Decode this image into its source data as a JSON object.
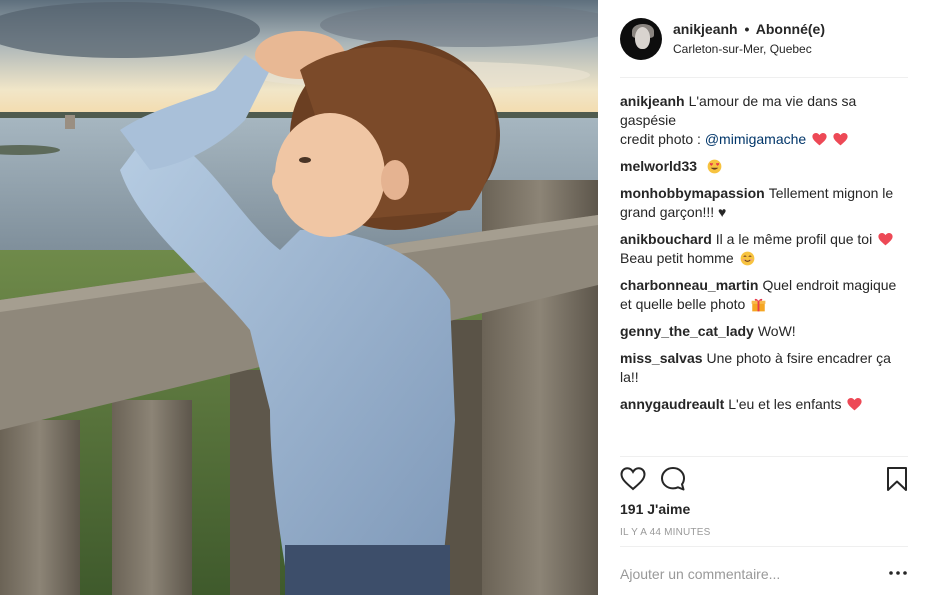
{
  "header": {
    "username": "anikjeanh",
    "separator": "•",
    "follow_status": "Abonné(e)",
    "location": "Carleton-sur-Mer, Quebec"
  },
  "caption": {
    "user": "anikjeanh",
    "text_line1": "L'amour de ma vie dans sa gaspésie",
    "text_prefix": "credit photo :",
    "mention": "@mimigamache",
    "emoji": [
      "red-heart",
      "red-heart"
    ]
  },
  "comments": [
    {
      "user": "melworld33",
      "text": "",
      "emoji": "heart-eyes-face"
    },
    {
      "user": "monhobbymapassion",
      "text": "Tellement mignon le grand garçon!!! ♥",
      "emoji": ""
    },
    {
      "user": "anikbouchard",
      "text": "Il a le même profil que toi",
      "text2": "Beau petit homme",
      "emoji": "red-heart",
      "emoji2": "smiling-face"
    },
    {
      "user": "charbonneau_martin",
      "text": "Quel endroit magique et quelle belle photo",
      "emoji": "gift"
    },
    {
      "user": "genny_the_cat_lady",
      "text": "WoW!",
      "emoji": ""
    },
    {
      "user": "miss_salvas",
      "text": "Une photo à fsire encadrer ça la!!",
      "emoji": ""
    },
    {
      "user": "annygaudreault",
      "text": "L'eu et les enfants",
      "emoji": "red-heart"
    }
  ],
  "actions": {
    "like_icon": "heart-outline-icon",
    "comment_icon": "speech-bubble-icon",
    "save_icon": "bookmark-icon"
  },
  "likes": "191 J'aime",
  "timestamp": "IL Y A 44 MINUTES",
  "add_comment": {
    "placeholder": "Ajouter un commentaire...",
    "value": ""
  },
  "more_icon": "ellipsis-icon",
  "colors": {
    "text": "#262626",
    "muted": "#999999",
    "mention": "#003569",
    "heart": "#ed4956",
    "divider": "#efefef"
  }
}
